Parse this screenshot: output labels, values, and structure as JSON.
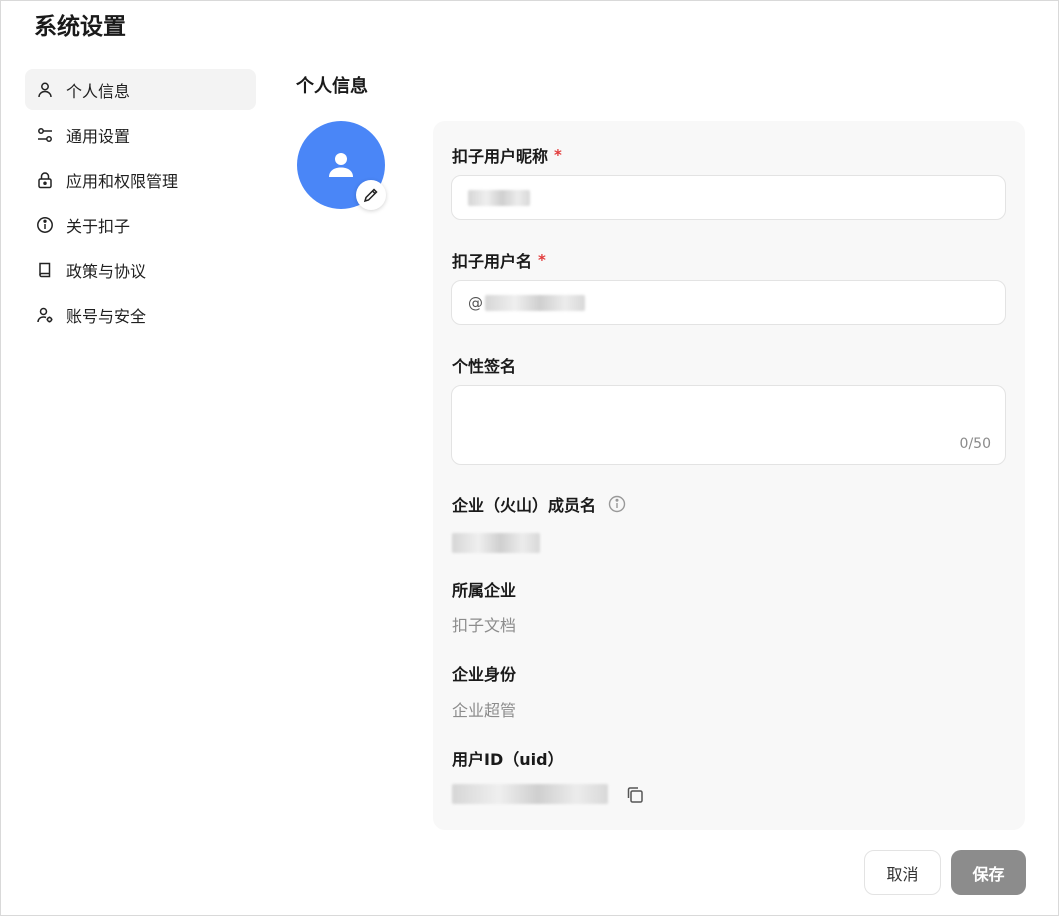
{
  "window": {
    "title": "系统设置"
  },
  "sidebar": {
    "items": [
      {
        "label": "个人信息",
        "icon": "user-icon"
      },
      {
        "label": "通用设置",
        "icon": "sliders-icon"
      },
      {
        "label": "应用和权限管理",
        "icon": "lock-icon"
      },
      {
        "label": "关于扣子",
        "icon": "info-icon"
      },
      {
        "label": "政策与协议",
        "icon": "book-icon"
      },
      {
        "label": "账号与安全",
        "icon": "user-gear-icon"
      }
    ]
  },
  "main": {
    "title": "个人信息",
    "avatar_color": "#4a86f7",
    "form": {
      "nickname_label": "扣子用户昵称",
      "required_mark": "*",
      "username_label": "扣子用户名",
      "username_prefix": "@",
      "signature_label": "个性签名",
      "signature_value": "",
      "signature_counter": "0/50",
      "member_name_label": "企业（火山）成员名",
      "enterprise_label": "所属企业",
      "enterprise_value": "扣子文档",
      "identity_label": "企业身份",
      "identity_value": "企业超管",
      "uid_label": "用户ID（uid）"
    },
    "buttons": {
      "cancel": "取消",
      "save": "保存"
    }
  }
}
